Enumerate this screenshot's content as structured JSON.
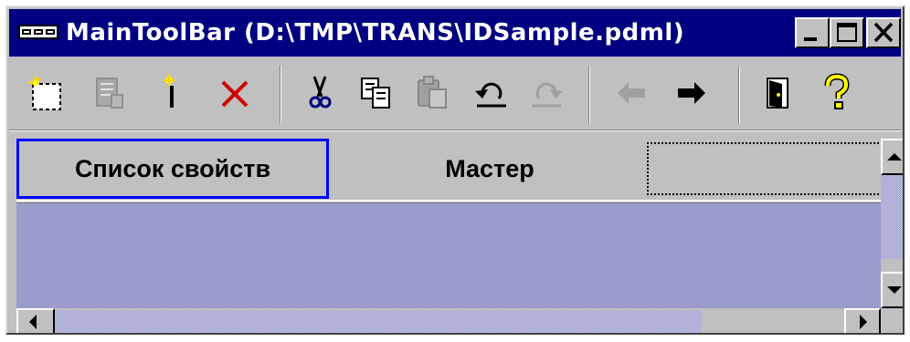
{
  "window": {
    "title": "MainToolBar (D:\\TMP\\TRANS\\IDSample.pdml)"
  },
  "title_buttons": [
    "minimize-icon",
    "maximize-icon",
    "close-icon"
  ],
  "toolbar": {
    "groups": [
      [
        "new-selection-icon",
        "properties-icon",
        "magic-wand-icon",
        "delete-icon"
      ],
      [
        "cut-icon",
        "copy-icon",
        "paste-icon",
        "undo-icon",
        "redo-icon"
      ],
      [
        "back-arrow-icon",
        "forward-arrow-icon"
      ],
      [
        "exit-door-icon",
        "help-icon"
      ]
    ],
    "disabled": [
      "properties-icon",
      "paste-icon",
      "redo-icon",
      "back-arrow-icon"
    ]
  },
  "tabs": [
    {
      "label": "Список свойств",
      "active": true
    },
    {
      "label": "Мастер",
      "active": false
    },
    {
      "label": "",
      "active": false
    }
  ],
  "colors": {
    "titlebar": "#000080",
    "content_background": "#9b9bcd",
    "active_tab_border": "#0000ff",
    "delete_icon": "#cc0000"
  }
}
